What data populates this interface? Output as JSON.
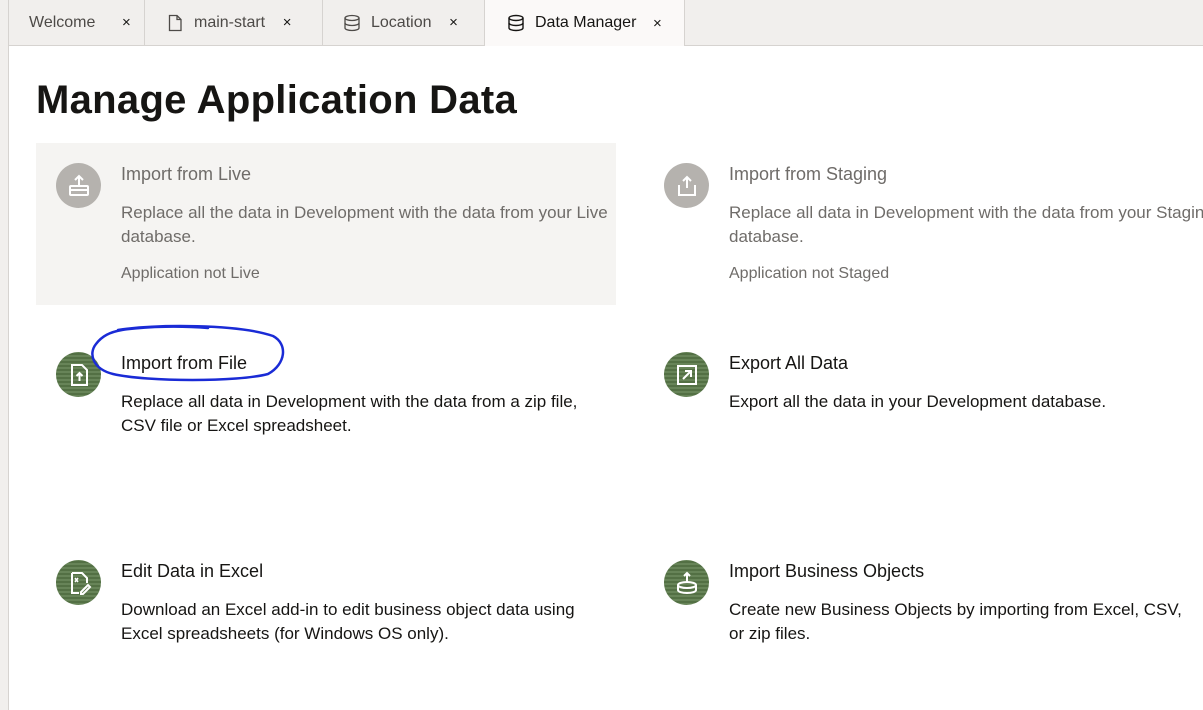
{
  "tabs": [
    {
      "label": "Welcome",
      "icon": "none",
      "close": "×"
    },
    {
      "label": "main-start",
      "icon": "file-icon",
      "close": "×"
    },
    {
      "label": "Location",
      "icon": "database-icon",
      "close": "×"
    },
    {
      "label": "Data Manager",
      "icon": "database-icon",
      "close": "×",
      "active": true
    }
  ],
  "page": {
    "title": "Manage Application Data"
  },
  "cards": {
    "import_live": {
      "title": "Import from Live",
      "description": "Replace all the data in Development with the data from your Live database.",
      "status": "Application not Live",
      "icon": "upload-tray-icon",
      "enabled": false
    },
    "import_staging": {
      "title": "Import from Staging",
      "description": "Replace all data in Development with the data from your Staging database.",
      "status": "Application not Staged",
      "icon": "upload-box-icon",
      "enabled": false
    },
    "import_file": {
      "title": "Import from File",
      "description": "Replace all data in Development with the data from a zip file, CSV file or Excel spreadsheet.",
      "icon": "file-upload-icon",
      "enabled": true
    },
    "export_all": {
      "title": "Export All Data",
      "description": "Export all the data in your Development database.",
      "icon": "export-arrow-icon",
      "enabled": true
    },
    "edit_excel": {
      "title": "Edit Data in Excel",
      "description": "Download an Excel add-in to edit business object data using Excel spreadsheets (for Windows OS only).",
      "icon": "excel-edit-icon",
      "enabled": true
    },
    "import_business_objects": {
      "title": "Import Business Objects",
      "description": "Create new Business Objects by importing from Excel, CSV, or zip files.",
      "icon": "database-upload-icon",
      "enabled": true
    }
  },
  "colors": {
    "icon_green": "#5a7a4a",
    "icon_gray": "#b5b2ae",
    "disabled_bg": "#f5f4f2",
    "annotation_blue": "#1a2bd6"
  }
}
